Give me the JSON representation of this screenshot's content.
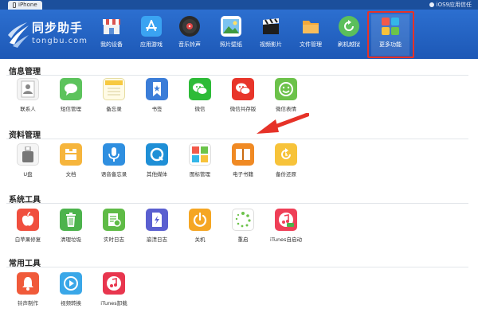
{
  "titlebar": {
    "device_tab": "iPhone",
    "trust_label": "iOS9应用信任"
  },
  "logo": {
    "name_cn": "同步助手",
    "name_en": "tongbu.com"
  },
  "nav": [
    {
      "label": "我的设备",
      "icon": "store-icon"
    },
    {
      "label": "应用游戏",
      "icon": "app-store-icon"
    },
    {
      "label": "音乐铃声",
      "icon": "music-disc-icon"
    },
    {
      "label": "照片壁纸",
      "icon": "photo-icon"
    },
    {
      "label": "视频影片",
      "icon": "film-clapper-icon"
    },
    {
      "label": "文件管理",
      "icon": "folder-icon"
    },
    {
      "label": "刷机越狱",
      "icon": "refresh-icon"
    },
    {
      "label": "更多功能",
      "icon": "tiles-icon"
    }
  ],
  "sections": [
    {
      "title": "信息管理",
      "items": [
        {
          "label": "联系人",
          "icon": "contacts-icon"
        },
        {
          "label": "短信管理",
          "icon": "message-bubble-icon"
        },
        {
          "label": "备忘录",
          "icon": "notes-icon"
        },
        {
          "label": "书签",
          "icon": "bookmark-icon"
        },
        {
          "label": "微信",
          "icon": "wechat-icon"
        },
        {
          "label": "微信共存版",
          "icon": "wechat-coexist-icon"
        },
        {
          "label": "微信表情",
          "icon": "smiley-icon"
        }
      ]
    },
    {
      "title": "资料管理",
      "items": [
        {
          "label": "U盘",
          "icon": "usb-drive-icon"
        },
        {
          "label": "文档",
          "icon": "document-icon"
        },
        {
          "label": "语音备忘录",
          "icon": "microphone-icon"
        },
        {
          "label": "其他媒体",
          "icon": "media-icon"
        },
        {
          "label": "图标管理",
          "icon": "icon-grid-icon"
        },
        {
          "label": "电子书籍",
          "icon": "ebook-icon"
        },
        {
          "label": "备份还原",
          "icon": "backup-icon"
        }
      ]
    },
    {
      "title": "系统工具",
      "items": [
        {
          "label": "白苹果修复",
          "icon": "apple-repair-icon"
        },
        {
          "label": "清理垃圾",
          "icon": "trash-icon"
        },
        {
          "label": "实时日志",
          "icon": "log-icon"
        },
        {
          "label": "崩溃日志",
          "icon": "crash-log-icon"
        },
        {
          "label": "关机",
          "icon": "power-icon"
        },
        {
          "label": "重启",
          "icon": "restart-icon"
        },
        {
          "label": "iTunes自启动",
          "icon": "itunes-autostart-icon"
        }
      ]
    },
    {
      "title": "常用工具",
      "items": [
        {
          "label": "铃声制作",
          "icon": "bell-icon"
        },
        {
          "label": "视频转换",
          "icon": "video-convert-icon"
        },
        {
          "label": "iTunes卸载",
          "icon": "itunes-uninstall-icon"
        }
      ]
    }
  ],
  "colors": {
    "header": "#1d58b6",
    "highlight": "#e63228",
    "arrow": "#e63228"
  }
}
